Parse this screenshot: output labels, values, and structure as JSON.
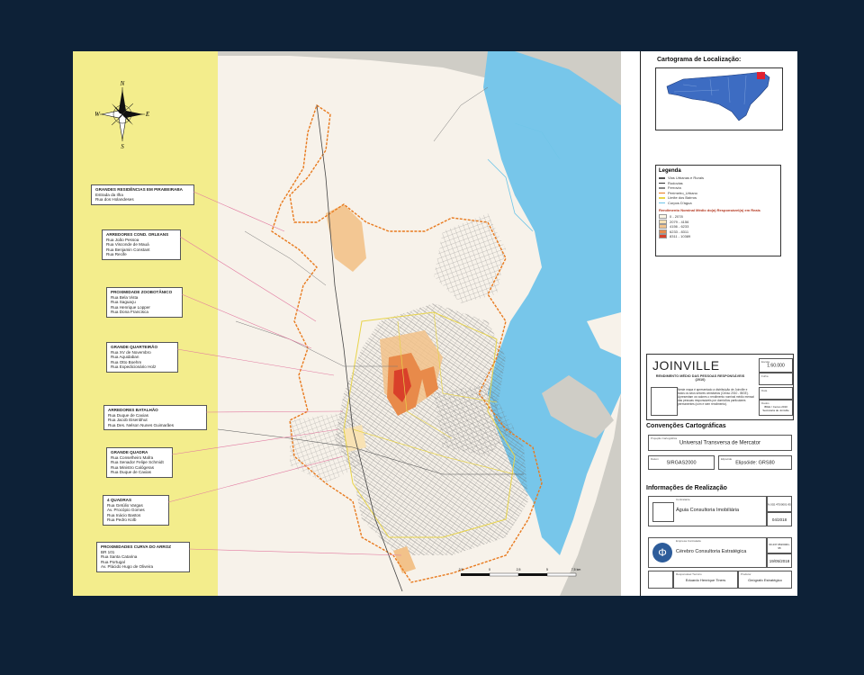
{
  "map": {
    "title": "JOINVILLE",
    "subtitle": "RENDIMENTO MÉDIO DAS PESSOAS RESPONSÁVEIS (2010)",
    "scale": "1:60.000",
    "description": "Neste mapa é apresentado a distribuição de Joinville e todos os seus setores censitários (Censo 2010 - IBGE). Apresentam os valores o rendimento nominal médio mensal das pessoas responsáveis por domicílios particulares permanentes (com e sem rendimento).",
    "scalebar_ticks": [
      "2,5",
      "0",
      "2,5",
      "5",
      "7,5 km"
    ],
    "compass": {
      "n": "N",
      "s": "S",
      "e": "E",
      "w": "W"
    }
  },
  "callouts": [
    {
      "title": "GRANDES RESIDÊNCIAS EM PIRABEIRABA",
      "lines": [
        "Estrada da Ilha",
        "Rua dos Holandeses"
      ]
    },
    {
      "title": "ARREDORES COND. ORLEANS",
      "lines": [
        "Rua João Pessoa",
        "Rua Visconde de Mauá",
        "Rua Benjamin Constant",
        "Rua Recife"
      ]
    },
    {
      "title": "PROXIMIDADE ZOOBOTÂNICO",
      "lines": [
        "Rua Bela Vista",
        "Rua Saguaçu",
        "Rua Henrique Lopper",
        "Rua Dona Francisca"
      ]
    },
    {
      "title": "GRANDE QUARTEIRÃO",
      "lines": [
        "Rua XV de Novembro",
        "Rua Aquidaban",
        "Rua Otto Boehm",
        "Rua Expedicionário Holz"
      ]
    },
    {
      "title": "ARREDORES BATALHÃO",
      "lines": [
        "Rua Duque de Caxias",
        "Rua Jacob Eisenbhut",
        "Rua Des. Nelson Nunes Guimarães"
      ]
    },
    {
      "title": "GRANDE QUADRA",
      "lines": [
        "Rua Conselheiro Mafra",
        "Rua Senador Felipe Schmidt",
        "Rua Ministro Calógeras",
        "Rua Duque de Caxias"
      ]
    },
    {
      "title": "4 QUADRAS",
      "lines": [
        "Rua Getúlio Vargas",
        "Av. Procópio Gomes",
        "Rua Inácio Bastos",
        "Rua Pedro Kolb"
      ]
    },
    {
      "title": "PROXIMIDADES CURVA DO ARROZ",
      "lines": [
        "BR 101",
        "Rua Santa Catarina",
        "Rua Portugal",
        "Av. Plácido Hugo de Oliveira"
      ]
    }
  ],
  "panel": {
    "location_title": "Cartograma de Localização:",
    "legend_title": "Legenda",
    "legend_lines": [
      {
        "label": "Vias Urbanas e Rurais",
        "color": "#555555"
      },
      {
        "label": "Rodovias",
        "color": "#333333"
      },
      {
        "label": "Ferrovia",
        "color": "#888888"
      },
      {
        "label": "Perímetro_Urbano",
        "color": "#e87a1e"
      },
      {
        "label": "Limite dos Bairros",
        "color": "#e8d44a"
      },
      {
        "label": "Corpos D'água",
        "color": "#6fc5e8"
      }
    ],
    "income_title": "Rendimento Nominal Médio do(a) Responsável(a) em Reais",
    "income_classes": [
      {
        "label": "0 - 2078",
        "color": "#fbf6e6"
      },
      {
        "label": "2079 - 4156",
        "color": "#f8e2b4"
      },
      {
        "label": "4156 - 6233",
        "color": "#f2c28a"
      },
      {
        "label": "6233 - 8311",
        "color": "#e88a4a"
      },
      {
        "label": "8311 - 10389",
        "color": "#d9402a"
      }
    ],
    "conv_title": "Convenções Cartográficas",
    "projection_label": "Projeção Cartográfica",
    "projection": "Universal Transversa de Mercator",
    "datum_label": "Datum",
    "datum": "SIRGAS2000",
    "ellipsoid_label": "Elipsóide",
    "ellipsoid": "Elipsóide: GRS80",
    "info_title": "Informações de Realização",
    "contractor_label": "Contratante",
    "contractor": "Águia Consultoria Imobiliária",
    "date": "04/2018",
    "contractor_code": "N.002.475/0001-95",
    "company_label": "Empresa Contratada",
    "company": "Cérebro Consultoria Estratégica",
    "company_code": "00.437.952/0001-95",
    "company_date": "19/05/2018",
    "tech_label": "Responsável Técnico",
    "tech": "Eduardo Henrique Tiners",
    "producer_label": "Produtor",
    "producer": "Geógrafo Estratégico",
    "scale_label": "Escala",
    "page_label": "Folha",
    "date_label": "Data",
    "date_value_label": "Dados",
    "data_source": "IBGE / Censo 2010 Secretaria de Joinville",
    "logo_letter": "Φ"
  }
}
